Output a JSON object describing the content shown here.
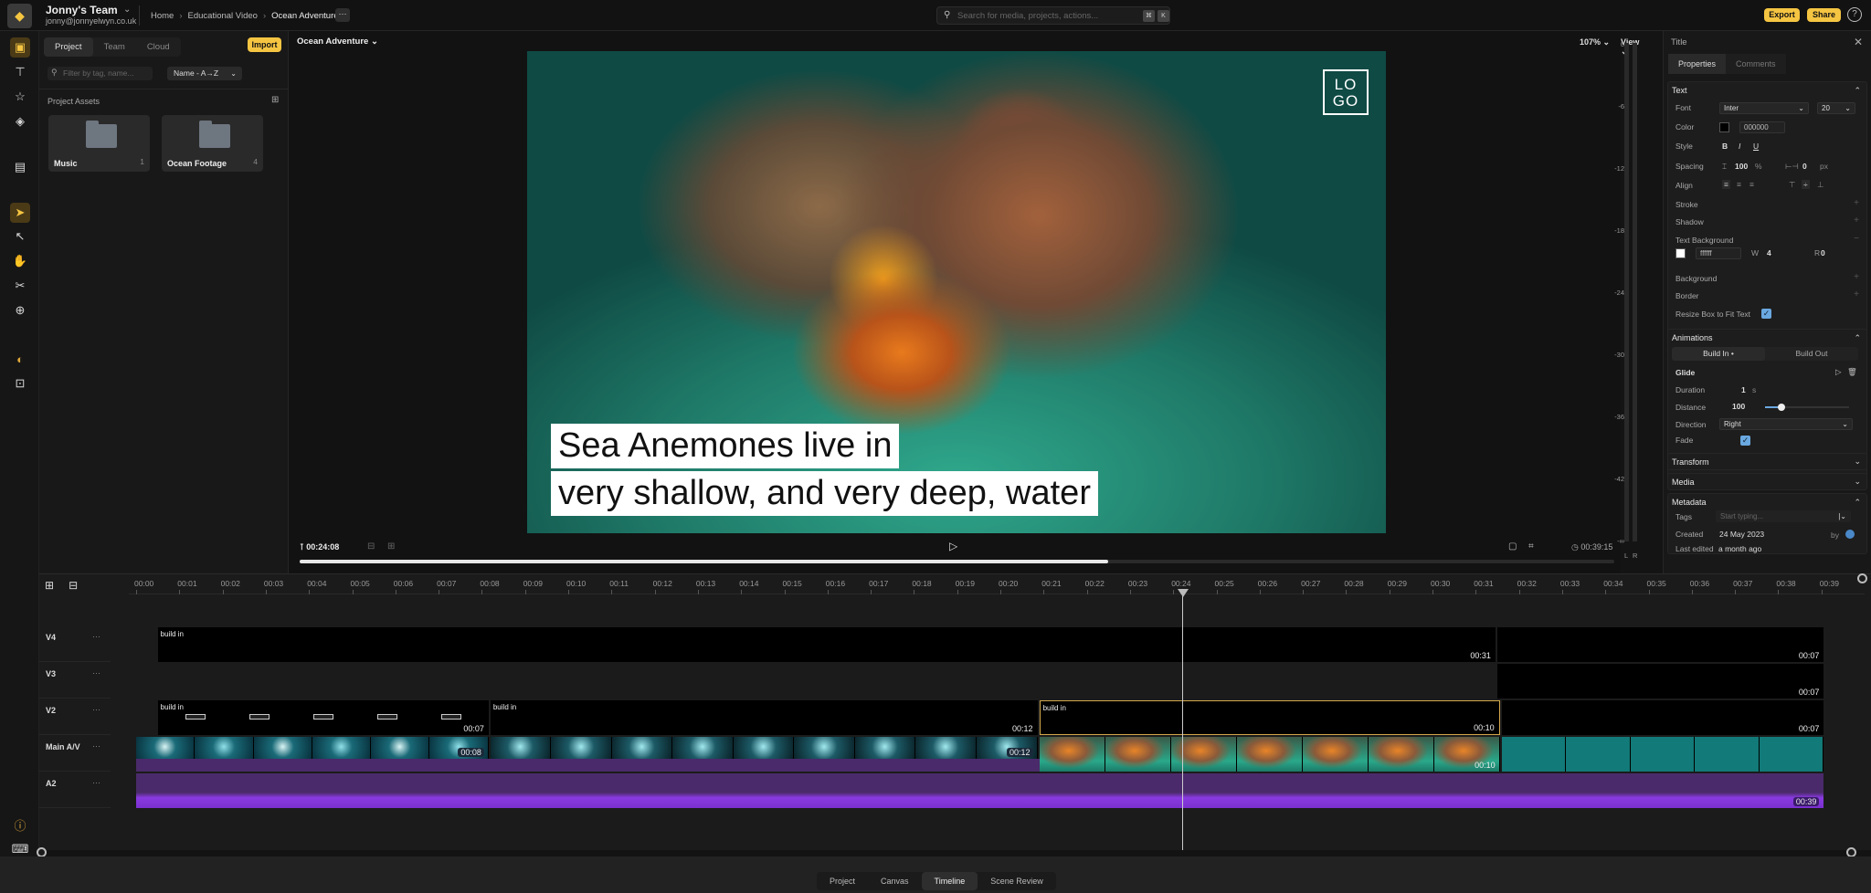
{
  "team": {
    "name": "Jonny's Team",
    "email": "jonny@jonnyelwyn.co.uk"
  },
  "breadcrumb": [
    "Home",
    "Educational Video",
    "Ocean Adventure"
  ],
  "search": {
    "placeholder": "Search for media, projects, actions...",
    "shortcut": [
      "⌘",
      "K"
    ]
  },
  "header_actions": {
    "export": "Export",
    "share": "Share",
    "help": "?"
  },
  "rail": {
    "tools": [
      "media-icon",
      "text-icon",
      "elements-icon",
      "transitions-icon",
      "captions-icon",
      "select-tool-icon",
      "ripple-tool-icon",
      "hand-tool-icon",
      "razor-tool-icon",
      "zoom-tool-icon",
      "color-icon",
      "aspect-icon",
      "info-icon",
      "keyboard-icon"
    ]
  },
  "assets": {
    "tabs": [
      {
        "label": "Project",
        "active": true
      },
      {
        "label": "Team",
        "active": false
      },
      {
        "label": "Cloud",
        "active": false
      }
    ],
    "import_label": "Import",
    "filter_placeholder": "Filter by tag, name...",
    "sort": "Name - A→Z",
    "section_title": "Project Assets",
    "folders": [
      {
        "name": "Music",
        "count": "1"
      },
      {
        "name": "Ocean Footage",
        "count": "4"
      }
    ]
  },
  "preview": {
    "composition": "Ocean Adventure",
    "zoom": "107%",
    "view_label": "View",
    "logo_text": "LO GO",
    "caption_lines": [
      "Sea Anemones live in",
      "very shallow, and very deep, water"
    ],
    "current_time": "00:24:08",
    "total_time": "00:39:15",
    "progress": 0.615,
    "meter_labels": [
      "0",
      "-6",
      "-12",
      "-18",
      "-24",
      "-30",
      "-36",
      "-42",
      "-∞"
    ],
    "meter_channels": [
      "L",
      "R"
    ]
  },
  "properties": {
    "title": "Title",
    "tabs": [
      {
        "label": "Properties",
        "active": true
      },
      {
        "label": "Comments",
        "active": false
      }
    ],
    "text": {
      "header": "Text",
      "font_label": "Font",
      "font": "Inter",
      "size": "20",
      "color_label": "Color",
      "color": "000000",
      "style_label": "Style",
      "style_buttons": [
        "B",
        "I",
        "U"
      ],
      "spacing_label": "Spacing",
      "line_spacing": "100",
      "line_unit": "%",
      "letter_spacing": "0",
      "letter_unit": "px",
      "align_label": "Align",
      "stroke": "Stroke",
      "shadow": "Shadow",
      "text_bg": "Text Background",
      "text_bg_color": "ffffff",
      "text_bg_w_label": "W",
      "text_bg_w": "4",
      "text_bg_r_label": "R",
      "text_bg_r": "0",
      "background": "Background",
      "border": "Border",
      "resize_label": "Resize Box to Fit Text",
      "resize_checked": true
    },
    "animations": {
      "header": "Animations",
      "tabs": [
        "Build In •",
        "Build Out"
      ],
      "effect": "Glide",
      "duration_label": "Duration",
      "duration": "1",
      "duration_unit": "s",
      "distance_label": "Distance",
      "distance": "100",
      "distance_slider": 0.2,
      "direction_label": "Direction",
      "direction": "Right",
      "fade_label": "Fade",
      "fade_checked": true
    },
    "transform": "Transform",
    "media": "Media",
    "metadata": {
      "header": "Metadata",
      "tags_label": "Tags",
      "tags_placeholder": "Start typing...",
      "created_label": "Created",
      "created": "24 May 2023",
      "by_label": "by",
      "edited_label": "Last edited",
      "edited": "a month ago"
    }
  },
  "timeline": {
    "ruler": [
      "00:00",
      "00:01",
      "00:02",
      "00:03",
      "00:04",
      "00:05",
      "00:06",
      "00:07",
      "00:08",
      "00:09",
      "00:10",
      "00:11",
      "00:12",
      "00:13",
      "00:14",
      "00:15",
      "00:16",
      "00:17",
      "00:18",
      "00:19",
      "00:20",
      "00:21",
      "00:22",
      "00:23",
      "00:24",
      "00:25",
      "00:26",
      "00:27",
      "00:28",
      "00:29",
      "00:30",
      "00:31",
      "00:32",
      "00:33",
      "00:34",
      "00:35",
      "00:36",
      "00:37",
      "00:38",
      "00:39"
    ],
    "playhead_seconds": 24.2,
    "tracks": [
      {
        "name": "V4",
        "more": "···"
      },
      {
        "name": "V3",
        "more": "···"
      },
      {
        "name": "V2",
        "more": "···"
      },
      {
        "name": "Main A/V",
        "more": "···"
      },
      {
        "name": "A2",
        "more": "···"
      }
    ],
    "clips": {
      "v4": [
        {
          "label": "build in",
          "duration": "00:31"
        },
        {
          "label": "",
          "duration": "00:07"
        }
      ],
      "v3": [
        {
          "label": "",
          "duration": "00:07"
        }
      ],
      "v2": [
        {
          "label": "build in",
          "duration": "00:07"
        },
        {
          "label": "build in",
          "duration": "00:12"
        },
        {
          "label": "build in",
          "duration": "00:10"
        },
        {
          "label": "",
          "duration": "00:07"
        }
      ],
      "main": [
        {
          "duration": "00:08"
        },
        {
          "duration": "00:12"
        },
        {
          "duration": "00:10"
        }
      ],
      "a2": [
        {
          "duration": "00:39"
        }
      ]
    }
  },
  "modes": [
    {
      "label": "Project",
      "active": false
    },
    {
      "label": "Canvas",
      "active": false
    },
    {
      "label": "Timeline",
      "active": true
    },
    {
      "label": "Scene Review",
      "active": false
    }
  ]
}
